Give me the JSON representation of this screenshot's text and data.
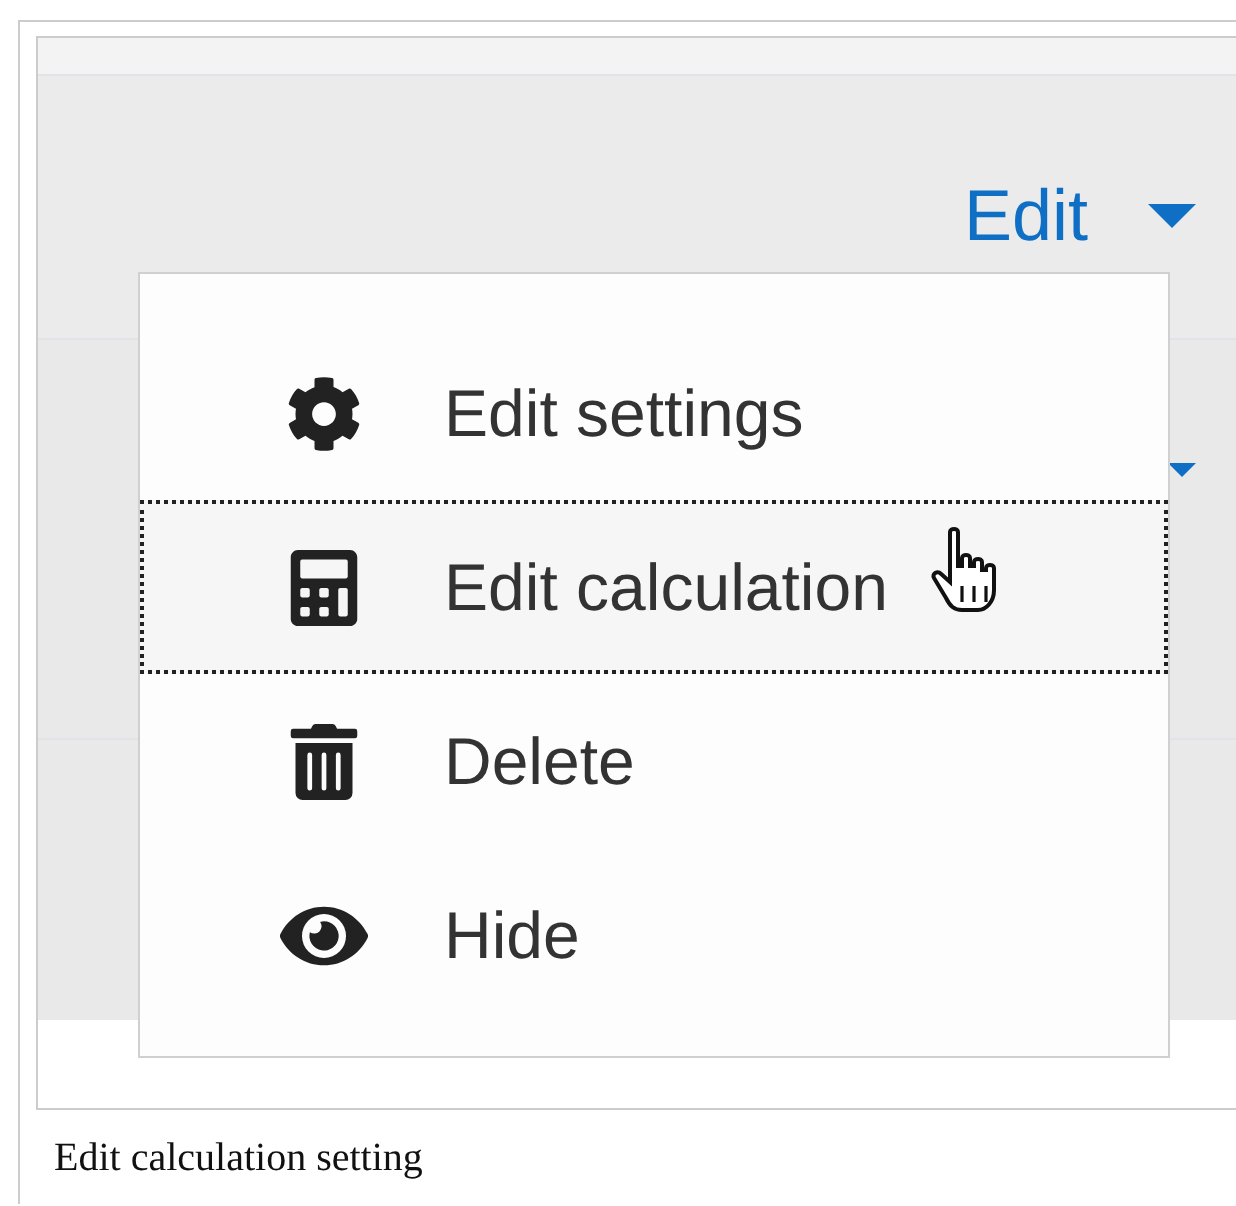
{
  "header": {
    "edit_menu": {
      "label": "Edit",
      "expanded": true
    }
  },
  "menu": {
    "items": [
      {
        "label": "Edit settings",
        "selected": false
      },
      {
        "label": "Edit calculation",
        "selected": true
      },
      {
        "label": "Delete",
        "selected": false
      },
      {
        "label": "Hide",
        "selected": false
      }
    ]
  },
  "caption": "Edit calculation setting"
}
